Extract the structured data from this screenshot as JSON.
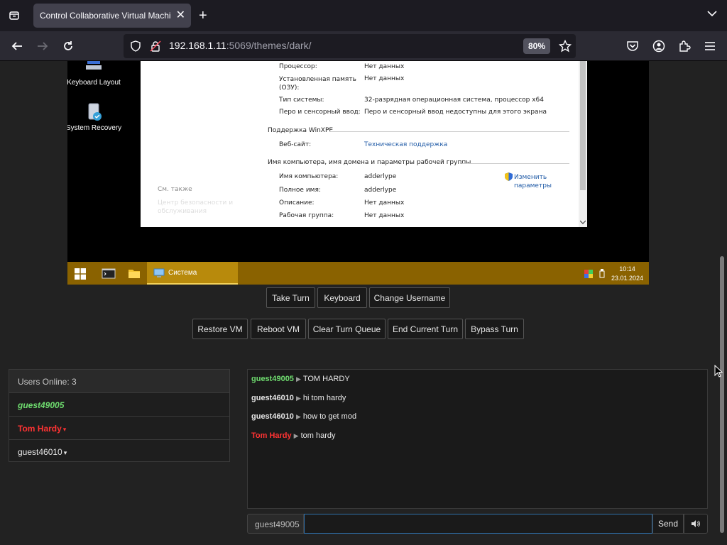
{
  "browser": {
    "tab_title": "Control Collaborative Virtual Machine",
    "close_tab": "✕",
    "new_tab": "+",
    "url_host": "192.168.1.11",
    "url_rest": ":5069/themes/dark/",
    "zoom": "80%"
  },
  "vm": {
    "desktop_icons": [
      {
        "label": "Keyboard Layout"
      },
      {
        "label": "System Recovery"
      }
    ],
    "sysinfo": {
      "rows_top": [
        {
          "label": "Процессор:",
          "value": "Нет данных"
        },
        {
          "label": "Установленная память (ОЗУ):",
          "value": "Нет данных"
        },
        {
          "label": "Тип системы:",
          "value": "32-разрядная операционная система, процессор x64"
        },
        {
          "label": "Перо и сенсорный ввод:",
          "value": "Перо и сенсорный ввод недоступны для этого экрана"
        }
      ],
      "support_section": "Поддержка WinXPE",
      "website_label": "Веб-сайт:",
      "website_value": "Техническая поддержка",
      "computer_section": "Имя компьютера, имя домена и параметры рабочей группы",
      "rows_computer": [
        {
          "label": "Имя компьютера:",
          "value": "adderlype"
        },
        {
          "label": "Полное имя:",
          "value": "adderlype"
        },
        {
          "label": "Описание:",
          "value": "Нет данных"
        },
        {
          "label": "Рабочая группа:",
          "value": "Нет данных"
        }
      ],
      "change_settings": "Изменить параметры",
      "see_also": "См. также",
      "security_center": "Центр безопасности и обслуживания"
    },
    "taskbar": {
      "active_task": "Система",
      "time": "10:14",
      "date": "23.01.2024"
    }
  },
  "controls": {
    "row1": [
      "Take Turn",
      "Keyboard",
      "Change Username"
    ],
    "row2": [
      "Restore VM",
      "Reboot VM",
      "Clear Turn Queue",
      "End Current Turn",
      "Bypass Turn"
    ]
  },
  "users": {
    "header": "Users Online: 3",
    "list": [
      {
        "name": "guest49005",
        "color": "#6fdc6f",
        "italic": true,
        "caret": ""
      },
      {
        "name": "Tom Hardy",
        "color": "#ff3333",
        "italic": false,
        "caret": "▾"
      },
      {
        "name": "guest46010",
        "color": "#e6e6e6",
        "italic": false,
        "caret": "▾"
      }
    ]
  },
  "chat": {
    "messages": [
      {
        "user": "guest49005",
        "color": "#6fdc6f",
        "text": "TOM HARDY"
      },
      {
        "user": "guest46010",
        "color": "#e6e6e6",
        "text": "hi tom hardy"
      },
      {
        "user": "guest46010",
        "color": "#e6e6e6",
        "text": "how to get mod"
      },
      {
        "user": "Tom Hardy",
        "color": "#ff3333",
        "text": "tom hardy"
      }
    ],
    "username": "guest49005",
    "input_value": "",
    "send_label": "Send",
    "arrow": "▶"
  }
}
